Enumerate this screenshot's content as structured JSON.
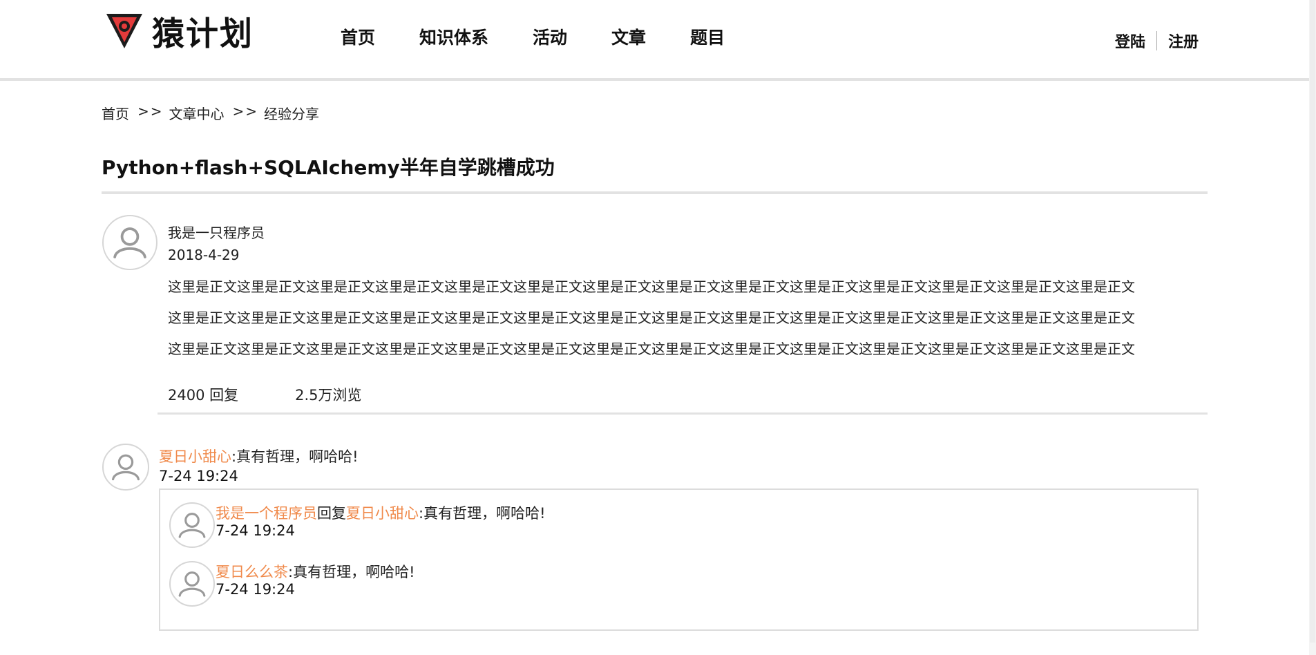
{
  "header": {
    "logo_text": "猿计划",
    "nav": [
      "首页",
      "知识体系",
      "活动",
      "文章",
      "题目"
    ],
    "login_label": "登陆",
    "register_label": "注册"
  },
  "breadcrumb": {
    "items": [
      "首页",
      "文章中心",
      "经验分享"
    ],
    "separator": ">>"
  },
  "post": {
    "title": "Python+flash+SQLAIchemy半年自学跳槽成功",
    "author": "我是一只程序员",
    "date": "2018-4-29",
    "body_lines": [
      "这里是正文这里是正文这里是正文这里是正文这里是正文这里是正文这里是正文这里是正文这里是正文这里是正文这里是正文这里是正文这里是正文这里是正文",
      "这里是正文这里是正文这里是正文这里是正文这里是正文这里是正文这里是正文这里是正文这里是正文这里是正文这里是正文这里是正文这里是正文这里是正文",
      "这里是正文这里是正文这里是正文这里是正文这里是正文这里是正文这里是正文这里是正文这里是正文这里是正文这里是正文这里是正文这里是正文这里是正文"
    ],
    "replies_count": "2400 回复",
    "views_count": "2.5万浏览"
  },
  "comments": [
    {
      "user": "夏日小甜心",
      "text": ":真有哲理，啊哈哈!",
      "time": "7-24 19:24",
      "replies": [
        {
          "user": "我是一个程序员",
          "reply_word": "回复",
          "target": "夏日小甜心",
          "text": ":真有哲理，啊哈哈!",
          "time": "7-24 19:24"
        },
        {
          "user": "夏日么么茶",
          "text": ":真有哲理，啊哈哈!",
          "time": "7-24 19:24"
        }
      ]
    }
  ],
  "colors": {
    "username": "#f08a4b",
    "divider": "#e2e2e2",
    "logo_red": "#e33b3b"
  },
  "icons": {
    "logo": "logo-triangle-icon",
    "avatar": "user-avatar-icon"
  }
}
